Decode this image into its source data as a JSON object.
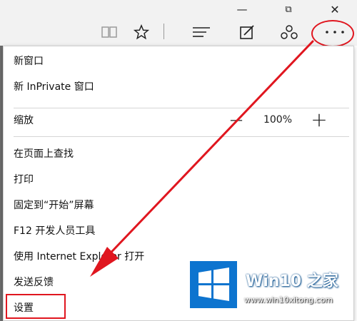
{
  "menu": {
    "new_window": "新窗口",
    "new_inprivate": "新 InPrivate 窗口",
    "zoom_label": "缩放",
    "zoom_out": "—",
    "zoom_value": "100%",
    "zoom_in": "+",
    "find_on_page": "在页面上查找",
    "print": "打印",
    "pin_to_start": "固定到“开始”屏幕",
    "dev_tools": "F12 开发人员工具",
    "open_with_ie": "使用 Internet Explorer 打开",
    "send_feedback": "发送反馈",
    "settings": "设置"
  },
  "window_controls": {
    "minimize": "—",
    "restore": "⧉",
    "close": "✕"
  },
  "toolbar_icons": [
    "reading-view-icon",
    "favorite-star-icon",
    "hub-icon",
    "web-note-icon",
    "share-icon",
    "more-actions-icon"
  ],
  "watermark": {
    "title": "Win10 之家",
    "url": "www.win10xitong.com"
  },
  "colors": {
    "annotation_red": "#e0161f",
    "watermark_blue": "#0d74cf"
  }
}
